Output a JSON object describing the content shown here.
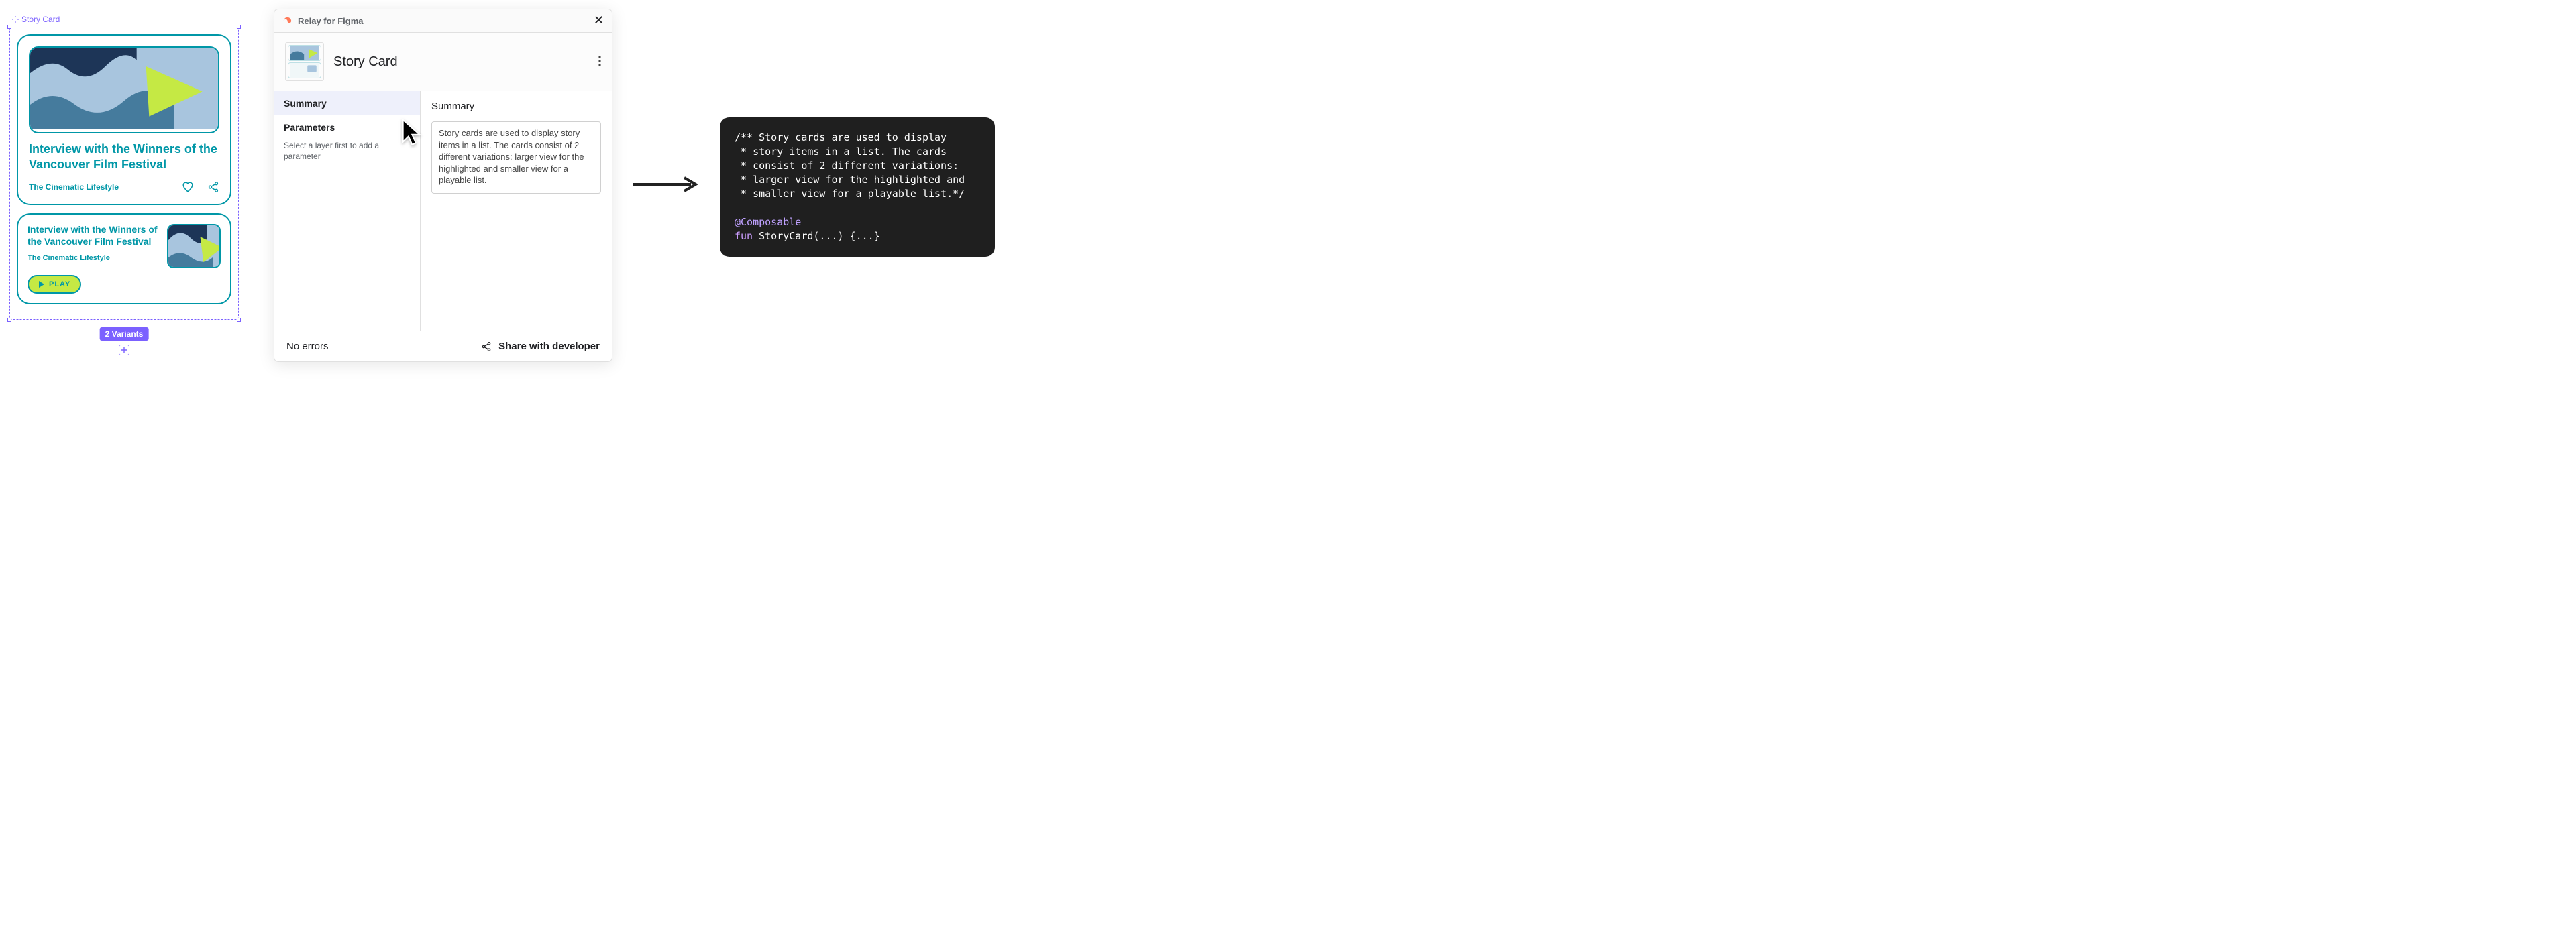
{
  "figma": {
    "frame_label": "Story Card",
    "variants_badge": "2 Variants",
    "card_large": {
      "title": "Interview with the Winners of the Vancouver Film Festival",
      "source": "The Cinematic Lifestyle"
    },
    "card_small": {
      "title": "Interview with the Winners of the Vancouver Film Festival",
      "source": "The Cinematic Lifestyle",
      "play_label": "PLAY"
    }
  },
  "relay": {
    "plugin_name": "Relay for Figma",
    "component_name": "Story Card",
    "sidebar": {
      "summary_label": "Summary",
      "parameters_label": "Parameters",
      "parameters_help": "Select a layer first to add a parameter"
    },
    "main": {
      "heading": "Summary",
      "summary_text": "Story cards are used to display story items in a list. The cards consist of 2 different variations: larger view for the highlighted and smaller view for a playable list."
    },
    "footer": {
      "errors": "No errors",
      "share_label": "Share with developer"
    }
  },
  "code": {
    "comment_lines": [
      "/** Story cards are used to display",
      " * story items in a list. The cards",
      " * consist of 2 different variations:",
      " * larger view for the highlighted and",
      " * smaller view for a playable list.*/"
    ],
    "annotation": "@Composable",
    "fun_kw": "fun",
    "fun_sig": " StoryCard(...) {...}"
  }
}
